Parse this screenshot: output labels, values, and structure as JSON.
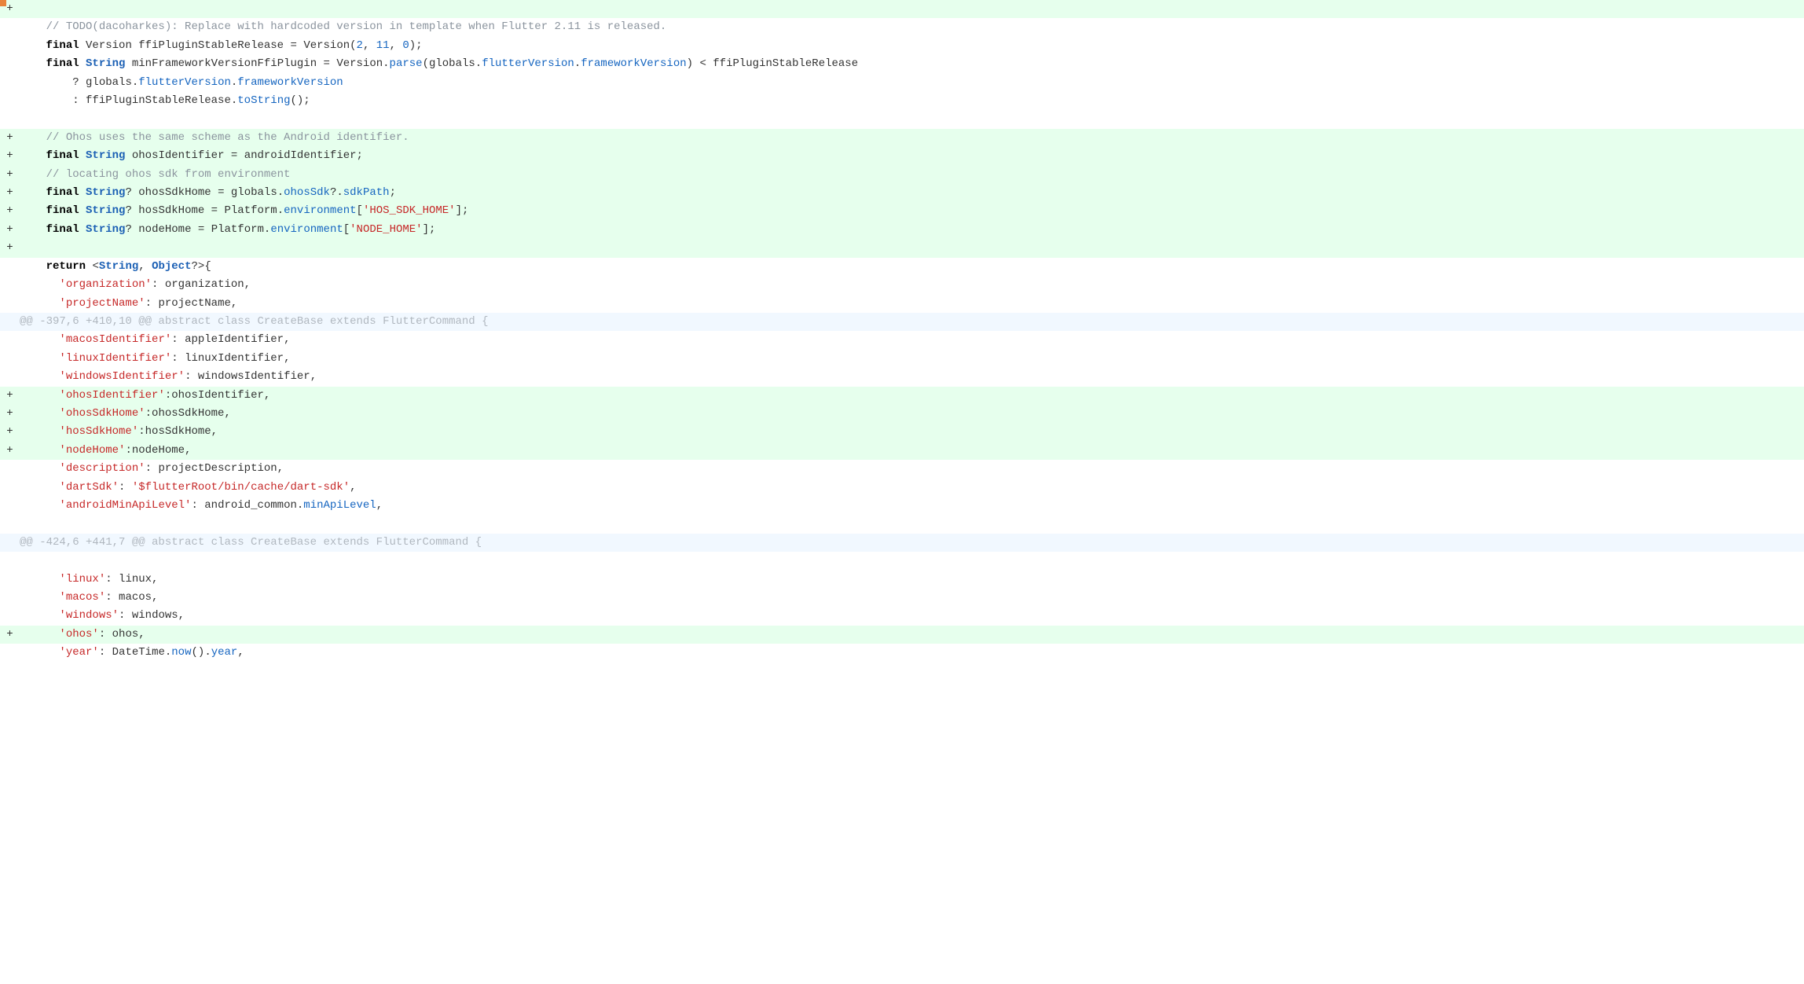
{
  "marker": "",
  "hunk1": "@@ -397,6 +410,10 @@ abstract class CreateBase extends FlutterCommand {",
  "hunk2": "@@ -424,6 +441,7 @@ abstract class CreateBase extends FlutterCommand {",
  "g_plus": "+",
  "l1_indent": "    ",
  "l1_comment": "// TODO(dacoharkes): Replace with hardcoded version in template when Flutter 2.11 is released.",
  "l2_indent": "    ",
  "l2_final": "final",
  "l2_sp1": " ",
  "l2_version1": "Version",
  "l2_sp2": " ",
  "l2_name": "ffiPluginStableRelease",
  "l2_eq": " = ",
  "l2_version2": "Version",
  "l2_open": "(",
  "l2_n1": "2",
  "l2_c1": ", ",
  "l2_n2": "11",
  "l2_c2": ", ",
  "l2_n3": "0",
  "l2_close": ");",
  "l3_indent": "    ",
  "l3_final": "final",
  "l3_sp1": " ",
  "l3_type": "String",
  "l3_sp2": " ",
  "l3_name": "minFrameworkVersionFfiPlugin",
  "l3_eq": " = ",
  "l3_version": "Version",
  "l3_dot1": ".",
  "l3_parse": "parse",
  "l3_open": "(",
  "l3_globals": "globals",
  "l3_dot2": ".",
  "l3_fv": "flutterVersion",
  "l3_dot3": ".",
  "l3_fwv": "frameworkVersion",
  "l3_close": ")",
  "l3_lt": " < ",
  "l3_rhs": "ffiPluginStableRelease",
  "l4_indent": "        ",
  "l4_q": "? ",
  "l4_globals": "globals",
  "l4_dot1": ".",
  "l4_fv": "flutterVersion",
  "l4_dot2": ".",
  "l4_fwv": "frameworkVersion",
  "l5_indent": "        ",
  "l5_colon": ": ",
  "l5_name": "ffiPluginStableRelease",
  "l5_dot": ".",
  "l5_method": "toString",
  "l5_call": "();",
  "l6_indent": "    ",
  "l6_comment": "// Ohos uses the same scheme as the Android identifier.",
  "l7_indent": "    ",
  "l7_final": "final",
  "l7_sp1": " ",
  "l7_type": "String",
  "l7_sp2": " ",
  "l7_name": "ohosIdentifier",
  "l7_eq": " = ",
  "l7_rhs": "androidIdentifier;",
  "l8_indent": "    ",
  "l8_comment": "// locating ohos sdk from environment",
  "l9_indent": "    ",
  "l9_final": "final",
  "l9_sp1": " ",
  "l9_type": "String",
  "l9_q": "?",
  "l9_sp2": " ",
  "l9_name": "ohosSdkHome",
  "l9_eq": " = ",
  "l9_globals": "globals",
  "l9_dot1": ".",
  "l9_ohossdk": "ohosSdk",
  "l9_qdot": "?.",
  "l9_sdkpath": "sdkPath",
  "l9_semi": ";",
  "l10_indent": "    ",
  "l10_final": "final",
  "l10_sp1": " ",
  "l10_type": "String",
  "l10_q": "?",
  "l10_sp2": " ",
  "l10_name": "hosSdkHome",
  "l10_eq": " = ",
  "l10_platform": "Platform",
  "l10_dot": ".",
  "l10_env": "environment",
  "l10_open": "[",
  "l10_str": "'HOS_SDK_HOME'",
  "l10_close": "];",
  "l11_indent": "    ",
  "l11_final": "final",
  "l11_sp1": " ",
  "l11_type": "String",
  "l11_q": "?",
  "l11_sp2": " ",
  "l11_name": "nodeHome",
  "l11_eq": " = ",
  "l11_platform": "Platform",
  "l11_dot": ".",
  "l11_env": "environment",
  "l11_open": "[",
  "l11_str": "'NODE_HOME'",
  "l11_close": "];",
  "l12_indent": "    ",
  "l12_return": "return",
  "l12_sp": " ",
  "l12_lt": "<",
  "l12_string": "String",
  "l12_comma": ", ",
  "l12_object": "Object",
  "l12_q": "?",
  "l12_gt": ">",
  "l12_brace": "{",
  "l13_indent": "      ",
  "l13_key": "'organization'",
  "l13_colon": ": ",
  "l13_val": "organization,",
  "l14_indent": "      ",
  "l14_key": "'projectName'",
  "l14_colon": ": ",
  "l14_val": "projectName,",
  "l15_indent": "      ",
  "l15_key": "'macosIdentifier'",
  "l15_colon": ": ",
  "l15_val": "appleIdentifier,",
  "l16_indent": "      ",
  "l16_key": "'linuxIdentifier'",
  "l16_colon": ": ",
  "l16_val": "linuxIdentifier,",
  "l17_indent": "      ",
  "l17_key": "'windowsIdentifier'",
  "l17_colon": ": ",
  "l17_val": "windowsIdentifier,",
  "l18_indent": "      ",
  "l18_key": "'ohosIdentifier'",
  "l18_colon": ":",
  "l18_val": "ohosIdentifier,",
  "l19_indent": "      ",
  "l19_key": "'ohosSdkHome'",
  "l19_colon": ":",
  "l19_val": "ohosSdkHome,",
  "l20_indent": "      ",
  "l20_key": "'hosSdkHome'",
  "l20_colon": ":",
  "l20_val": "hosSdkHome,",
  "l21_indent": "      ",
  "l21_key": "'nodeHome'",
  "l21_colon": ":",
  "l21_val": "nodeHome,",
  "l22_indent": "      ",
  "l22_key": "'description'",
  "l22_colon": ": ",
  "l22_val": "projectDescription,",
  "l23_indent": "      ",
  "l23_key": "'dartSdk'",
  "l23_colon": ": ",
  "l23_val": "'$flutterRoot/bin/cache/dart-sdk'",
  "l23_comma": ",",
  "l24_indent": "      ",
  "l24_key": "'androidMinApiLevel'",
  "l24_colon": ": ",
  "l24_obj": "android_common",
  "l24_dot": ".",
  "l24_prop": "minApiLevel",
  "l24_comma": ",",
  "l25_indent": "      ",
  "l25_key": "'linux'",
  "l25_colon": ": ",
  "l25_val": "linux,",
  "l26_indent": "      ",
  "l26_key": "'macos'",
  "l26_colon": ": ",
  "l26_val": "macos,",
  "l27_indent": "      ",
  "l27_key": "'windows'",
  "l27_colon": ": ",
  "l27_val": "windows,",
  "l28_indent": "      ",
  "l28_key": "'ohos'",
  "l28_colon": ": ",
  "l28_val": "ohos,",
  "l29_indent": "      ",
  "l29_key": "'year'",
  "l29_colon": ": ",
  "l29_dt": "DateTime",
  "l29_dot1": ".",
  "l29_now": "now",
  "l29_call": "()",
  "l29_dot2": ".",
  "l29_year": "year",
  "l29_comma": ","
}
